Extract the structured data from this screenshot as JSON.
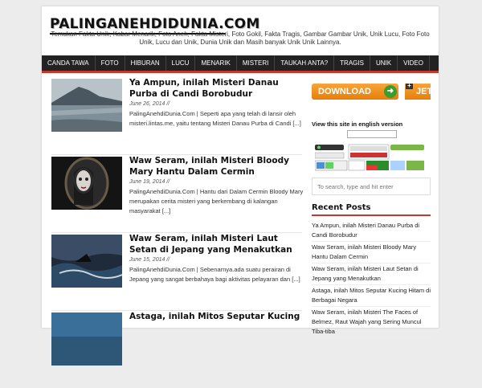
{
  "header": {
    "site_title": "PALINGANEHDIDUNIA.COM",
    "tagline": "Temukan Fakta Unik, Kabar Menarik, Foto Aneh, Fakta Misteri, Foto Gokil, Fakta Tragis, Gambar Gambar Unik, Unik Lucu, Foto Foto Unik, Lucu dan Unik, Dunia Unik dan Masih banyak Unik Unik Lainnya."
  },
  "nav": {
    "items": [
      "CANDA TAWA",
      "FOTO",
      "HIBURAN",
      "LUCU",
      "MENARIK",
      "MISTERI",
      "TAUKAH ANTA?",
      "TRAGIS",
      "UNIK",
      "VIDEO"
    ]
  },
  "posts": [
    {
      "title": "Ya Ampun, inilah Misteri Danau Purba di Candi Borobudur",
      "date": "June 26, 2014 //",
      "excerpt": "PalingAnehdiDunia.Com | Seperti apa yang telah di lansir oleh misteri.lintas.me, yaitu tentang Misteri Danau Purba di Candi [...]"
    },
    {
      "title": "Waw Seram, inilah Misteri Bloody Mary Hantu Dalam Cermin",
      "date": "June 19, 2014 //",
      "excerpt": "PalingAnehdiDunia.Com | Hantu dari Dalam Cermin Bloody Mary merupakan cerita misteri yang berkembang di kalangan masyarakat [...]"
    },
    {
      "title": "Waw Seram, inilah Misteri Laut Setan di Jepang yang Menakutkan",
      "date": "June 15, 2014 //",
      "excerpt": "PalingAnehdiDunia.Com | Sebenarnya.ada suatu perairan di Jepang yang sangat berbahaya bagi aktivitas pelayaran dan [...]"
    },
    {
      "title": "Astaga, inilah Mitos Seputar Kucing",
      "date": "",
      "excerpt": ""
    }
  ],
  "sidebar": {
    "download_label": "DOWNLOAD",
    "jet_label": "JET",
    "english_label": "View this site in english version",
    "search_placeholder": "To search, type and hit enter",
    "recent_heading": "Recent Posts",
    "recent_posts": [
      "Ya Ampun, inilah Misteri Danau Purba di Candi Borobudur",
      "Waw Seram, inilah Misteri Bloody Mary Hantu Dalam Cermin",
      "Waw Seram, inilah Misteri Laut Setan di Jepang yang Menakutkan",
      "Astaga, inilah Mitos Seputar Kucing Hitam di Berbagai Negara",
      "Waw Seram, inilah Misteri The Faces of Belmez, Raut Wajah yang Sering Muncul Tiba-tiba"
    ]
  },
  "colors": {
    "accent": "#c0392b",
    "nav_bg": "#222222",
    "download_orange": "#f0901c"
  }
}
